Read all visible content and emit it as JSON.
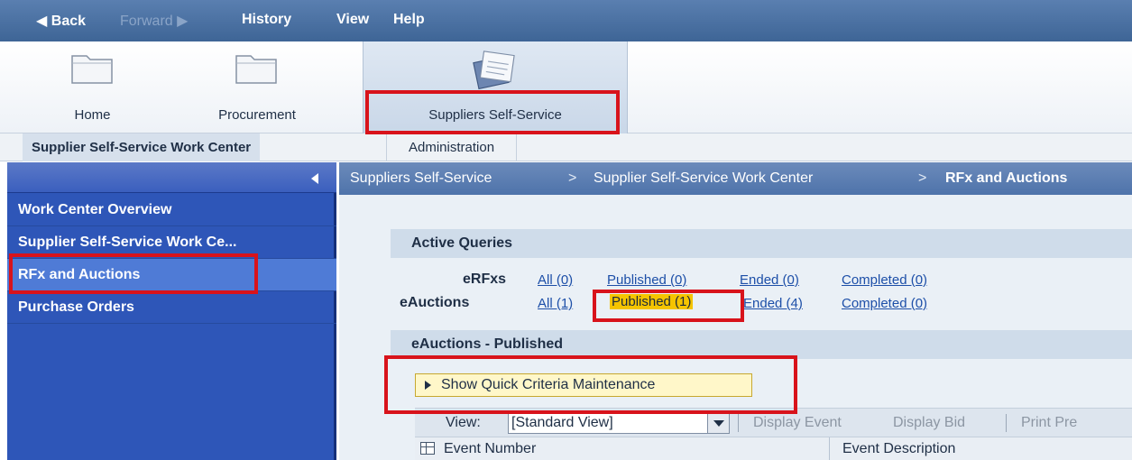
{
  "menu": {
    "back": "Back",
    "forward": "Forward",
    "history": "History",
    "view": "View",
    "help": "Help"
  },
  "nav_tabs": [
    {
      "label": "Home",
      "icon": "folder-icon"
    },
    {
      "label": "Procurement",
      "icon": "folder-icon"
    },
    {
      "label": "Suppliers Self-Service",
      "icon": "documents-icon"
    }
  ],
  "sub_tabs": [
    {
      "label": "Supplier Self-Service Work Center"
    },
    {
      "label": "Administration"
    }
  ],
  "left_nav": {
    "items": [
      {
        "label": "Work Center Overview"
      },
      {
        "label": "Supplier Self-Service Work Ce..."
      },
      {
        "label": "RFx and Auctions"
      },
      {
        "label": "Purchase Orders"
      }
    ]
  },
  "breadcrumb": {
    "items": [
      "Suppliers Self-Service",
      "Supplier Self-Service Work Center",
      "RFx and Auctions"
    ],
    "separator": ">"
  },
  "active_queries": {
    "title": "Active Queries",
    "rows": [
      {
        "label": "eRFxs",
        "links": [
          "All (0)",
          "Published (0)",
          "Ended (0)",
          "Completed (0)"
        ]
      },
      {
        "label": "eAuctions",
        "links": [
          "All (1)",
          "Published (1)",
          "Ended (4)",
          "Completed (0)"
        ]
      }
    ]
  },
  "results": {
    "title": "eAuctions - Published",
    "quick_criteria": "Show Quick Criteria Maintenance",
    "view_label": "View:",
    "view_value": "[Standard View]",
    "buttons": [
      "Display Event",
      "Display Bid",
      "Print Pre"
    ],
    "columns": [
      "Event Number",
      "Event Description"
    ]
  },
  "colors": {
    "accent_blue": "#2e56b8",
    "highlight": "#f5c400",
    "annotation_red": "#d8131b"
  }
}
